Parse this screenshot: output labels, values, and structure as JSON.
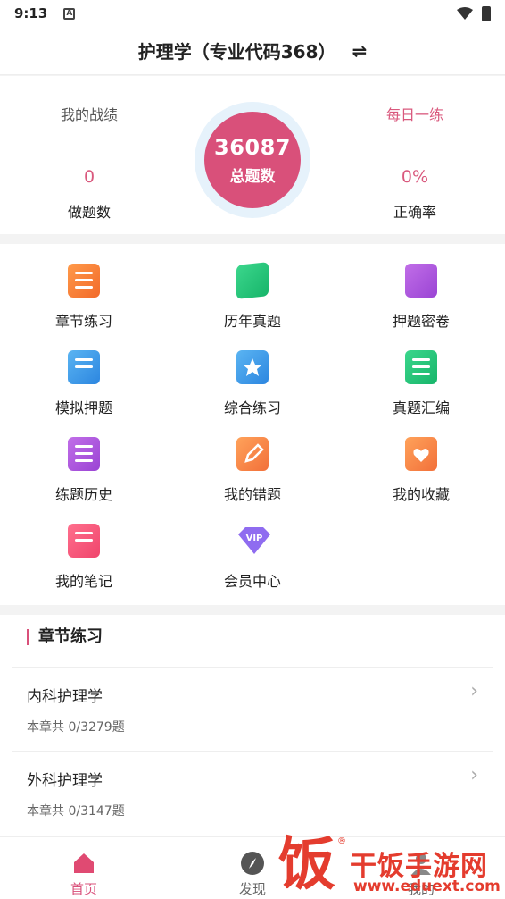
{
  "status_bar": {
    "time": "9:13",
    "notif_letter": "A"
  },
  "header": {
    "title": "护理学（专业代码368）",
    "switch_symbol": "⇌"
  },
  "stats": {
    "my_record_label": "我的战绩",
    "daily_practice_label": "每日一练",
    "total_questions": "36087",
    "total_questions_label": "总题数",
    "done_count": "0",
    "done_label": "做题数",
    "accuracy": "0%",
    "accuracy_label": "正确率"
  },
  "menu": [
    {
      "label": "章节练习",
      "icon": "list-icon"
    },
    {
      "label": "历年真题",
      "icon": "book-icon"
    },
    {
      "label": "押题密卷",
      "icon": "bookmark-book-icon"
    },
    {
      "label": "模拟押题",
      "icon": "doc-add-icon"
    },
    {
      "label": "综合练习",
      "icon": "star-notebook-icon"
    },
    {
      "label": "真题汇编",
      "icon": "doc-lines-icon"
    },
    {
      "label": "练题历史",
      "icon": "checklist-icon"
    },
    {
      "label": "我的错题",
      "icon": "pencil-icon"
    },
    {
      "label": "我的收藏",
      "icon": "heart-folder-icon"
    },
    {
      "label": "我的笔记",
      "icon": "note-calendar-icon"
    },
    {
      "label": "会员中心",
      "icon": "vip-diamond-icon"
    }
  ],
  "chapter_section": {
    "title": "章节练习",
    "items": [
      {
        "name": "内科护理学",
        "meta": "本章共  0/3279题"
      },
      {
        "name": "外科护理学",
        "meta": "本章共  0/3147题"
      }
    ]
  },
  "bottom_nav": [
    {
      "label": "首页",
      "icon": "home-icon",
      "active": true
    },
    {
      "label": "发现",
      "icon": "compass-icon",
      "active": false
    },
    {
      "label": "我的",
      "icon": "user-icon",
      "active": false
    }
  ],
  "watermark": {
    "logo_char": "饭",
    "brand": "干饭手游网",
    "url": "www.eduext.com"
  },
  "colors": {
    "accent": "#d9507a",
    "ring": "#e6f2fb"
  }
}
